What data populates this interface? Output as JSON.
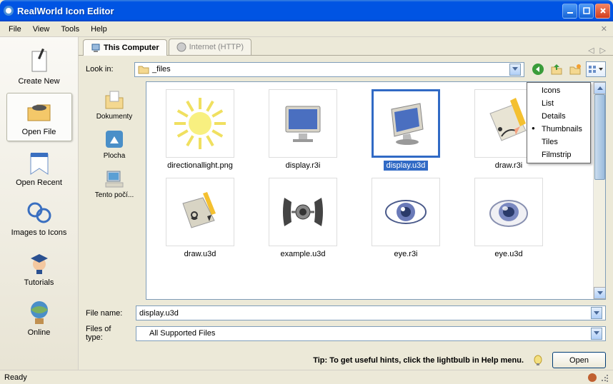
{
  "title": "RealWorld Icon Editor",
  "menus": [
    "File",
    "View",
    "Tools",
    "Help"
  ],
  "left_panel": [
    {
      "id": "create-new",
      "label": "Create New"
    },
    {
      "id": "open-file",
      "label": "Open File",
      "selected": true
    },
    {
      "id": "open-recent",
      "label": "Open Recent"
    },
    {
      "id": "images-to-icons",
      "label": "Images to Icons"
    },
    {
      "id": "tutorials",
      "label": "Tutorials"
    },
    {
      "id": "online",
      "label": "Online"
    }
  ],
  "tabs": [
    {
      "id": "this-computer",
      "label": "This Computer",
      "active": true
    },
    {
      "id": "internet",
      "label": "Internet (HTTP)",
      "active": false
    }
  ],
  "lookin_label": "Look in:",
  "lookin_value": "_files",
  "places": [
    {
      "id": "dokumenty",
      "label": "Dokumenty"
    },
    {
      "id": "plocha",
      "label": "Plocha"
    },
    {
      "id": "tento-pocitac",
      "label": "Tento počí..."
    }
  ],
  "files": [
    {
      "name": "directionallight.png",
      "icon": "sun"
    },
    {
      "name": "display.r3i",
      "icon": "monitor-flat"
    },
    {
      "name": "display.u3d",
      "icon": "monitor-3d",
      "selected": true
    },
    {
      "name": "draw.r3i",
      "icon": "pencil-paper"
    },
    {
      "name": "draw.u3d",
      "icon": "pencil-paper-3d"
    },
    {
      "name": "example.u3d",
      "icon": "tie-fighter"
    },
    {
      "name": "eye.r3i",
      "icon": "eye"
    },
    {
      "name": "eye.u3d",
      "icon": "eye-3d"
    }
  ],
  "view_menu": [
    "Icons",
    "List",
    "Details",
    "Thumbnails",
    "Tiles",
    "Filmstrip"
  ],
  "view_selected": "Thumbnails",
  "filename_label": "File name:",
  "filename_value": "display.u3d",
  "filetype_label": "Files of type:",
  "filetype_value": "All Supported Files",
  "tip": "Tip: To get useful hints, click the lightbulb in Help menu.",
  "open_btn": "Open",
  "status": "Ready"
}
